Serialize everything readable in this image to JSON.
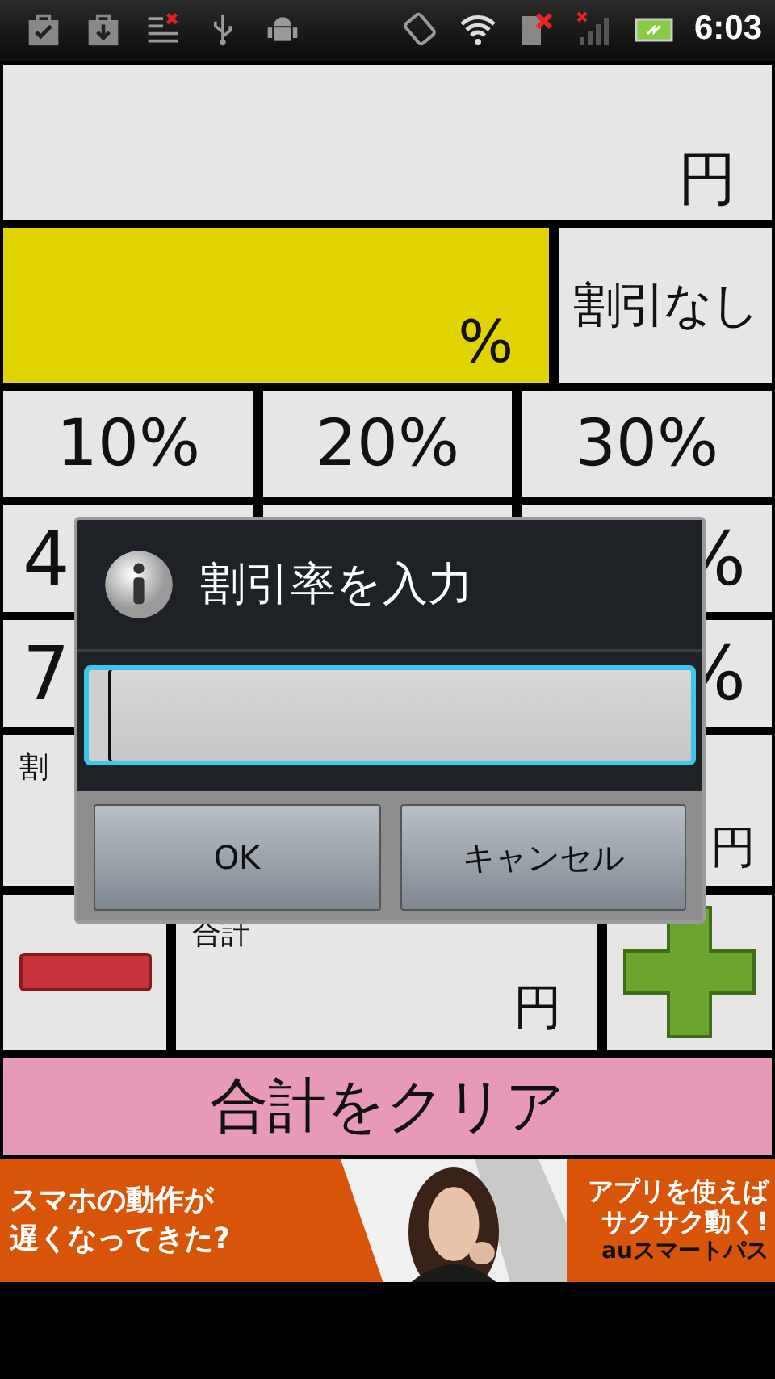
{
  "status_bar": {
    "time": "6:03"
  },
  "price": {
    "unit": "円"
  },
  "discount": {
    "unit": "%",
    "no_discount_button": "割引なし"
  },
  "rate_rows": [
    {
      "cells": [
        "10%",
        "20%",
        "30%"
      ]
    },
    {
      "cells": [
        "4",
        "%"
      ]
    },
    {
      "cells": [
        "7",
        "%"
      ]
    }
  ],
  "discounted": {
    "label": "割",
    "unit": "円"
  },
  "total": {
    "label": "合計",
    "unit": "円"
  },
  "clear_button": "合計をクリア",
  "ad": {
    "left_lines": [
      "スマホの**動作**が",
      "**遅く**なってきた?"
    ],
    "right_lines": [
      "アプリを使えば",
      "サクサク動く!"
    ],
    "brand": "auスマートパス"
  },
  "dialog": {
    "title": "割引率を入力",
    "input_focused": true,
    "buttons": [
      "OK",
      "キャンセル"
    ]
  }
}
